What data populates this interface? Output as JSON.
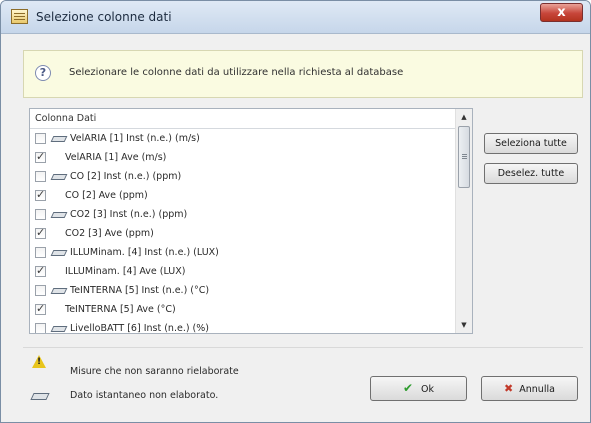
{
  "window": {
    "title": "Selezione colonne dati",
    "close_symbol": "x"
  },
  "info": {
    "icon": "help-question-icon",
    "text": "Selezionare le colonne dati da utilizzare nella richiesta al database"
  },
  "list": {
    "header": "Colonna Dati",
    "rows": [
      {
        "label": "VelARIA [1] Inst (n.e.) (m/s)",
        "checked": false,
        "pen": true
      },
      {
        "label": "VelARIA [1] Ave (m/s)",
        "checked": true,
        "pen": false
      },
      {
        "label": "CO [2] Inst (n.e.) (ppm)",
        "checked": false,
        "pen": true
      },
      {
        "label": "CO [2] Ave (ppm)",
        "checked": true,
        "pen": false
      },
      {
        "label": "CO2 [3] Inst (n.e.) (ppm)",
        "checked": false,
        "pen": true
      },
      {
        "label": "CO2 [3] Ave (ppm)",
        "checked": true,
        "pen": false
      },
      {
        "label": "ILLUMinam. [4] Inst (n.e.) (LUX)",
        "checked": false,
        "pen": true
      },
      {
        "label": "ILLUMinam. [4] Ave (LUX)",
        "checked": true,
        "pen": false
      },
      {
        "label": "TeINTERNA [5] Inst (n.e.) (°C)",
        "checked": false,
        "pen": true
      },
      {
        "label": "TeINTERNA [5] Ave (°C)",
        "checked": true,
        "pen": false
      },
      {
        "label": "LivelloBATT [6] Inst (n.e.) (%)",
        "checked": false,
        "pen": true
      }
    ]
  },
  "buttons": {
    "select_all": "Seleziona tutte",
    "deselect_all": "Deselez. tutte",
    "ok": "Ok",
    "cancel": "Annulla"
  },
  "legend": {
    "warning_text": "Misure che non saranno rielaborate",
    "pen_text": "Dato istantaneo non elaborato."
  }
}
